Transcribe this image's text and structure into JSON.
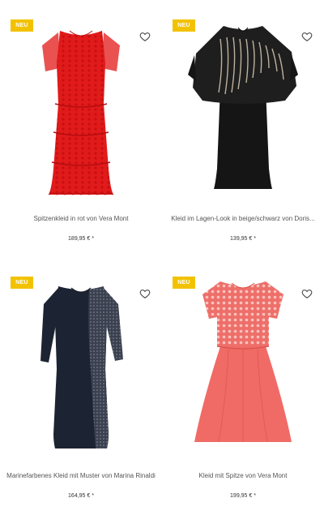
{
  "products": [
    {
      "badge": "NEU",
      "title": "Spitzenkleid in rot von Vera Mont",
      "price": "189,95 € *",
      "icon": "heart-outline-icon"
    },
    {
      "badge": "NEU",
      "title": "Kleid im Lagen-Look in beige/schwarz von Doris...",
      "price": "139,95 € *",
      "icon": "heart-outline-icon"
    },
    {
      "badge": "NEU",
      "title": "Marinefarbenes Kleid mit Muster von Marina Rinaldi",
      "price": "164,95 € *",
      "icon": "heart-outline-icon"
    },
    {
      "badge": "NEU",
      "title": "Kleid mit Spitze von Vera Mont",
      "price": "199,95 € *",
      "icon": "heart-outline-icon"
    }
  ],
  "colors": {
    "badge": "#f2c200",
    "red_dress": "#e11a1a",
    "black_dress": "#151515",
    "navy_dress": "#1c2433",
    "coral_dress": "#f06b66"
  }
}
